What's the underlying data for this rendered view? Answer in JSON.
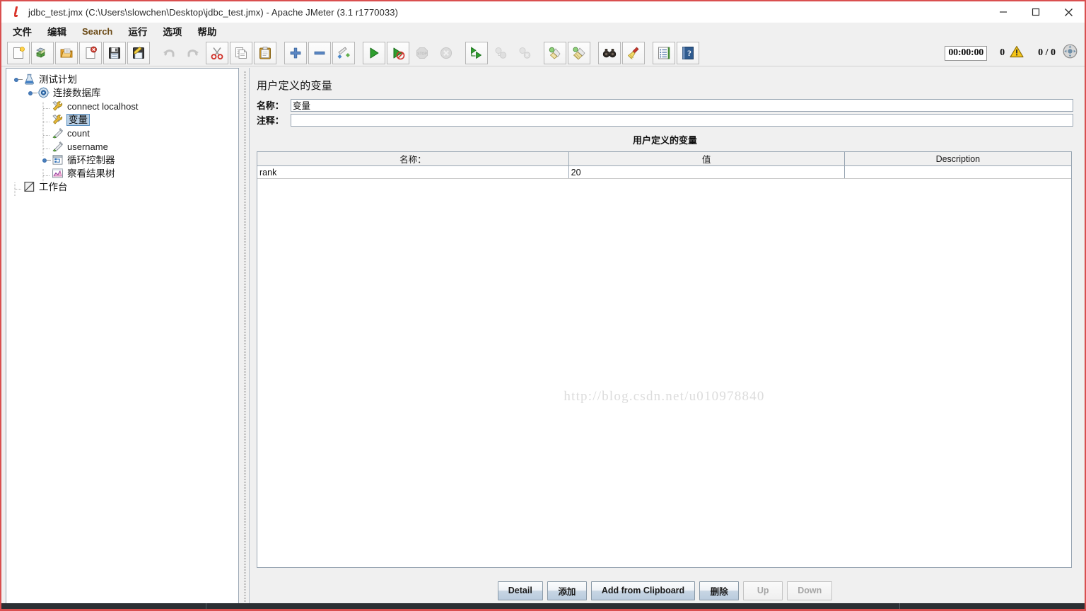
{
  "window": {
    "title": "jdbc_test.jmx (C:\\Users\\slowchen\\Desktop\\jdbc_test.jmx) - Apache JMeter (3.1 r1770033)",
    "app_icon": "jmeter-feather-icon",
    "minimize": "minimize-button",
    "maximize": "maximize-button",
    "close": "close-button",
    "border_color": "#d94f4f"
  },
  "menubar": {
    "items": [
      {
        "label": "文件",
        "name": "menu-file",
        "latin": false
      },
      {
        "label": "编辑",
        "name": "menu-edit",
        "latin": false
      },
      {
        "label": "Search",
        "name": "menu-search",
        "latin": true
      },
      {
        "label": "运行",
        "name": "menu-run",
        "latin": false
      },
      {
        "label": "选项",
        "name": "menu-options",
        "latin": false
      },
      {
        "label": "帮助",
        "name": "menu-help",
        "latin": false
      }
    ]
  },
  "toolbar": {
    "buttons": [
      {
        "name": "new-icon",
        "icon": "new",
        "disabled": false
      },
      {
        "name": "templates-icon",
        "icon": "templates",
        "disabled": false
      },
      {
        "name": "open-icon",
        "icon": "open",
        "disabled": false
      },
      {
        "name": "close-icon",
        "icon": "close-doc",
        "disabled": false
      },
      {
        "name": "save-icon",
        "icon": "save",
        "disabled": false
      },
      {
        "name": "save-as-icon",
        "icon": "save-as",
        "disabled": false
      },
      {
        "name": "separator-1",
        "icon": "sep",
        "disabled": false
      },
      {
        "name": "undo-icon",
        "icon": "undo",
        "disabled": true
      },
      {
        "name": "redo-icon",
        "icon": "redo",
        "disabled": true
      },
      {
        "name": "cut-icon",
        "icon": "cut",
        "disabled": false
      },
      {
        "name": "copy-icon",
        "icon": "copy",
        "disabled": false
      },
      {
        "name": "paste-icon",
        "icon": "paste",
        "disabled": false
      },
      {
        "name": "separator-2",
        "icon": "sep",
        "disabled": false
      },
      {
        "name": "expand-all-icon",
        "icon": "plus",
        "disabled": false
      },
      {
        "name": "collapse-all-icon",
        "icon": "minus",
        "disabled": false
      },
      {
        "name": "toggle-icon",
        "icon": "toggle",
        "disabled": false
      },
      {
        "name": "separator-3",
        "icon": "sep",
        "disabled": false
      },
      {
        "name": "start-icon",
        "icon": "start",
        "disabled": false
      },
      {
        "name": "start-no-pauses-icon",
        "icon": "start-no-pause",
        "disabled": false
      },
      {
        "name": "stop-icon",
        "icon": "stop",
        "disabled": true
      },
      {
        "name": "shutdown-icon",
        "icon": "shutdown",
        "disabled": true
      },
      {
        "name": "separator-4",
        "icon": "sep",
        "disabled": false
      },
      {
        "name": "start-remote-all-icon",
        "icon": "remote-start",
        "disabled": false
      },
      {
        "name": "stop-remote-all-icon",
        "icon": "remote-stop",
        "disabled": true
      },
      {
        "name": "shutdown-remote-all-icon",
        "icon": "remote-shutdown",
        "disabled": true
      },
      {
        "name": "separator-5",
        "icon": "sep",
        "disabled": false
      },
      {
        "name": "clear-icon",
        "icon": "clear",
        "disabled": false
      },
      {
        "name": "clear-all-icon",
        "icon": "clear-all",
        "disabled": false
      },
      {
        "name": "separator-6",
        "icon": "sep",
        "disabled": false
      },
      {
        "name": "search-icon",
        "icon": "binoculars",
        "disabled": false
      },
      {
        "name": "reset-search-icon",
        "icon": "broom",
        "disabled": false
      },
      {
        "name": "separator-7",
        "icon": "sep",
        "disabled": false
      },
      {
        "name": "function-helper-icon",
        "icon": "function-list",
        "disabled": false
      },
      {
        "name": "help-icon",
        "icon": "help-book",
        "disabled": false
      }
    ],
    "elapsed_time": "00:00:00",
    "warning_count": "0",
    "warning_icon": "warning-triangle-icon",
    "thread_counts": "0 / 0",
    "remote_icon": "run-indicator-icon"
  },
  "tree": {
    "nodes": [
      {
        "label": "测试计划",
        "name": "tree-node-test-plan",
        "icon": "test-plan-icon",
        "indent": 0,
        "handle": "expanded",
        "selected": false,
        "latin": false
      },
      {
        "label": "连接数据库",
        "name": "tree-node-thread-group",
        "icon": "thread-group-icon",
        "indent": 1,
        "handle": "expanded",
        "selected": false,
        "latin": false
      },
      {
        "label": "connect localhost",
        "name": "tree-node-connect-localhost",
        "icon": "config-element-icon",
        "indent": 2,
        "handle": "none",
        "selected": false,
        "latin": true
      },
      {
        "label": "变量",
        "name": "tree-node-variables",
        "icon": "config-element-icon",
        "indent": 2,
        "handle": "none",
        "selected": true,
        "latin": false
      },
      {
        "label": "count",
        "name": "tree-node-count",
        "icon": "counter-icon",
        "indent": 2,
        "handle": "none",
        "selected": false,
        "latin": true
      },
      {
        "label": "username",
        "name": "tree-node-username",
        "icon": "counter-icon",
        "indent": 2,
        "handle": "none",
        "selected": false,
        "latin": true
      },
      {
        "label": "循环控制器",
        "name": "tree-node-loop-controller",
        "icon": "controller-icon",
        "indent": 2,
        "handle": "expanded",
        "selected": false,
        "latin": false
      },
      {
        "label": "察看结果树",
        "name": "tree-node-view-results-tree",
        "icon": "listener-icon",
        "indent": 2,
        "handle": "none",
        "selected": false,
        "latin": false
      },
      {
        "label": "工作台",
        "name": "tree-node-workbench",
        "icon": "workbench-icon",
        "indent": 0,
        "handle": "none",
        "selected": false,
        "latin": false
      }
    ]
  },
  "panel": {
    "title": "用户定义的变量",
    "name_label": "名称：",
    "name_value": "变量",
    "comment_label": "注释：",
    "comment_value": "",
    "section_title": "用户定义的变量",
    "table": {
      "columns": [
        "名称：",
        "值",
        "Description"
      ],
      "rows": [
        {
          "name": "rank",
          "value": "20",
          "description": ""
        }
      ]
    },
    "watermark": "http://blog.csdn.net/u010978840",
    "buttons": [
      {
        "label": "Detail",
        "name": "detail-button",
        "disabled": false
      },
      {
        "label": "添加",
        "name": "add-button",
        "disabled": false
      },
      {
        "label": "Add from Clipboard",
        "name": "add-from-clipboard-button",
        "disabled": false
      },
      {
        "label": "删除",
        "name": "delete-button",
        "disabled": false
      },
      {
        "label": "Up",
        "name": "up-button",
        "disabled": true
      },
      {
        "label": "Down",
        "name": "down-button",
        "disabled": true
      }
    ]
  }
}
